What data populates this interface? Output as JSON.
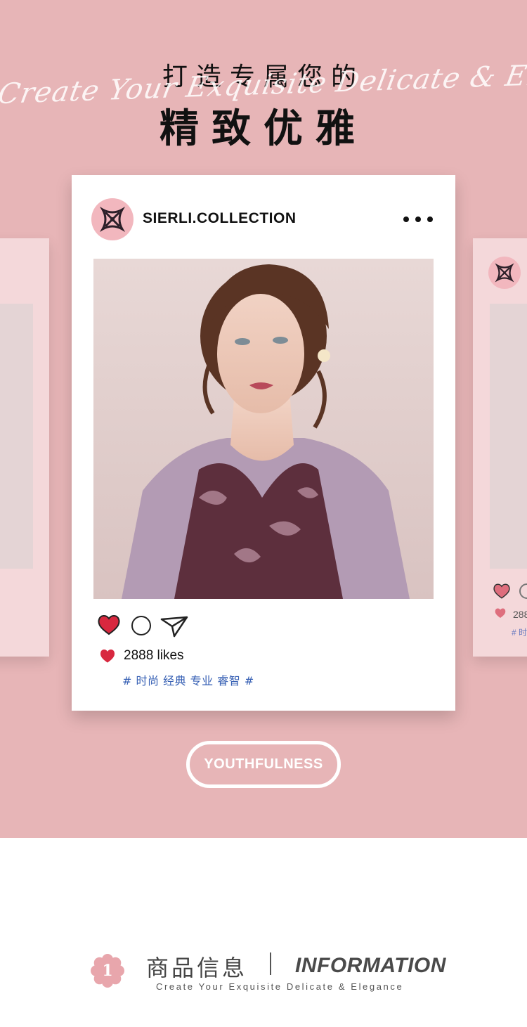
{
  "hero": {
    "script_text": "Create Your Exquisite Delicate & Elegance",
    "title_line1": "打造专属您的",
    "title_line2": "精致优雅",
    "background_color": "#e7b5b7"
  },
  "post": {
    "username": "SIERLI.COLLECTION",
    "more_icon": "ellipsis-icon",
    "avatar_icon": "brand-logo-icon",
    "actions": [
      {
        "name": "like",
        "icon": "heart-icon",
        "color": "#d8283f"
      },
      {
        "name": "comment",
        "icon": "comment-icon"
      },
      {
        "name": "share",
        "icon": "send-icon"
      }
    ],
    "likes_text": "2888 likes",
    "tags": "# 时尚 经典 专业 睿智 #"
  },
  "side_card_right": {
    "likes_text": "288",
    "tags_text": "# 时"
  },
  "cta": {
    "label": "YOUTHFULNESS"
  },
  "info": {
    "badge_number": "1",
    "title_cn": "商品信息",
    "title_en": "INFORMATION",
    "subtitle": "Create Your Exquisite Delicate & Elegance"
  }
}
